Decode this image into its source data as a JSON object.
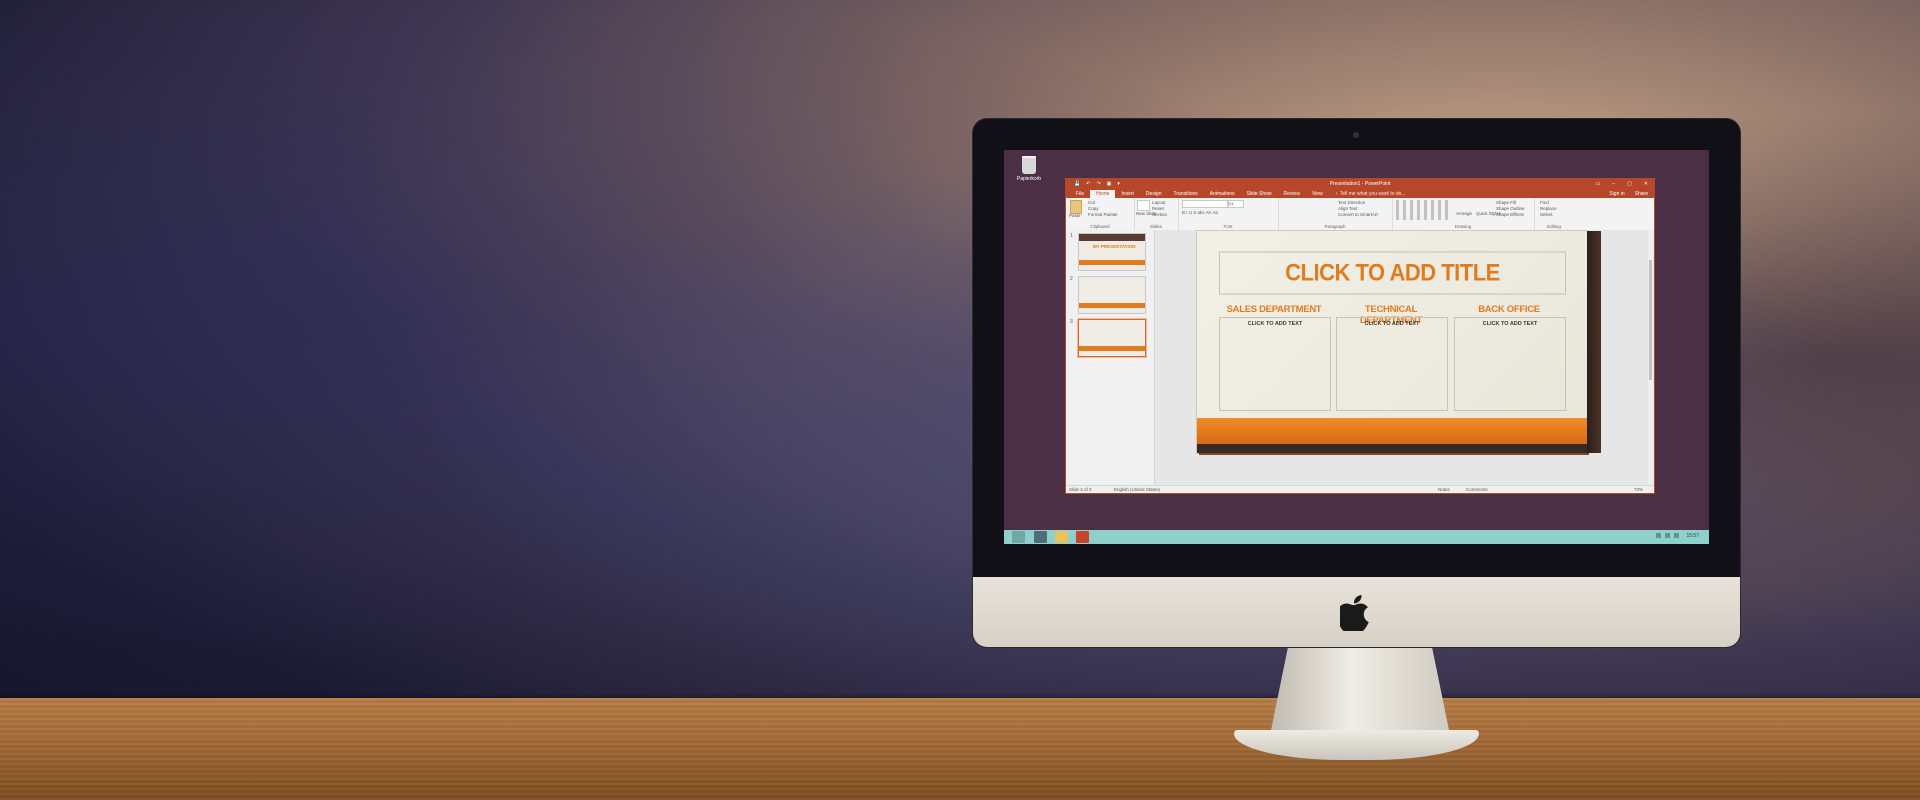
{
  "desktop": {
    "recycle_bin_label": "Papierkorb"
  },
  "window": {
    "title": "Presentation1 - PowerPoint",
    "qat": [
      "💾",
      "↶",
      "↷",
      "▣",
      "▾"
    ],
    "controls": [
      "▭",
      "–",
      "▢",
      "✕"
    ]
  },
  "ribbon_tabs": [
    "File",
    "Home",
    "Insert",
    "Design",
    "Transitions",
    "Animations",
    "Slide Show",
    "Review",
    "View"
  ],
  "tell_me": "♀ Tell me what you want to do...",
  "account": {
    "sign_in": "Sign in",
    "share": "Share"
  },
  "ribbon": {
    "clipboard": {
      "paste": "Paste",
      "cut": "Cut",
      "copy": "Copy",
      "format_painter": "Format Painter",
      "label": "Clipboard"
    },
    "slides": {
      "new_slide": "New Slide",
      "layout": "Layout",
      "reset": "Reset",
      "section": "Section",
      "label": "Slides"
    },
    "font": {
      "size": "24",
      "format_row": "B I U S abc AV Aa",
      "label": "Font"
    },
    "paragraph": {
      "text_direction": "Text Direction",
      "align_text": "Align Text",
      "convert_smartart": "Convert to SmartArt",
      "label": "Paragraph"
    },
    "drawing": {
      "arrange": "Arrange",
      "quick_styles": "Quick Styles",
      "shape_fill": "Shape Fill",
      "shape_outline": "Shape Outline",
      "shape_effects": "Shape Effects",
      "label": "Drawing"
    },
    "editing": {
      "find": "Find",
      "replace": "Replace",
      "select": "Select",
      "label": "Editing"
    }
  },
  "thumbnails": [
    {
      "num": "1",
      "title": "MY PRESENTATION"
    },
    {
      "num": "2",
      "title": ""
    },
    {
      "num": "3",
      "title": ""
    }
  ],
  "slide": {
    "title_placeholder": "CLICK TO ADD TITLE",
    "columns": [
      {
        "heading": "SALES DEPARTMENT",
        "text": "CLICK TO ADD TEXT"
      },
      {
        "heading": "TECHNICAL DEPARTMENT",
        "text": "CLICK TO ADD TEXT"
      },
      {
        "heading": "BACK OFFICE",
        "text": "CLICK TO ADD TEXT"
      }
    ],
    "accent_color": "#e07b20"
  },
  "status": {
    "slide_count": "Slide 3 of 3",
    "language": "English (United States)",
    "notes": "Notes",
    "comments": "Comments",
    "zoom": "73%"
  },
  "taskbar": {
    "time": "15:57"
  },
  "colors": {
    "ppt_brand": "#b7472a",
    "taskbar": "#8fd0cc",
    "screen_bg": "#4a2f45"
  }
}
